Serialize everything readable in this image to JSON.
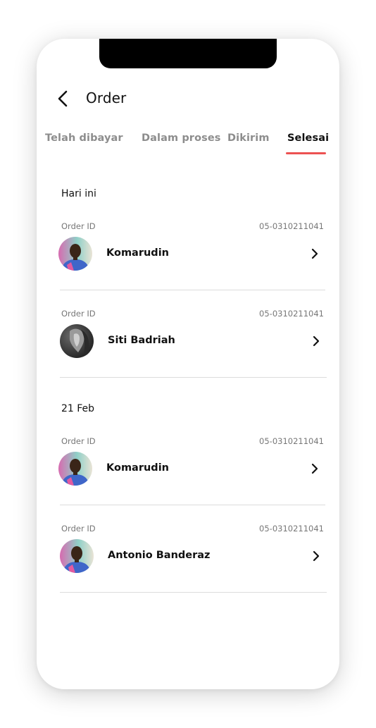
{
  "header": {
    "title": "Order",
    "back_icon": "chevron-left-icon"
  },
  "tabs": [
    {
      "label": "Telah dibayar",
      "active": false
    },
    {
      "label": "Dalam proses",
      "active": false
    },
    {
      "label": "Dikirim",
      "active": false
    },
    {
      "label": "Selesai",
      "active": true
    }
  ],
  "accent_color": "#ec5252",
  "sections": [
    {
      "title": "Hari ini",
      "orders": [
        {
          "order_id_label": "Order ID",
          "order_id": "05-0310211041",
          "name": "Komarudin",
          "avatar": "man-colorful-shirt-photo"
        },
        {
          "order_id_label": "Order ID",
          "order_id": "05-0310211041",
          "name": "Siti Badriah",
          "avatar": "woman-grayscale-photo"
        }
      ]
    },
    {
      "title": "21 Feb",
      "orders": [
        {
          "order_id_label": "Order ID",
          "order_id": "05-0310211041",
          "name": "Komarudin",
          "avatar": "man-colorful-shirt-photo"
        },
        {
          "order_id_label": "Order ID",
          "order_id": "05-0310211041",
          "name": "Antonio Banderaz",
          "avatar": "man-colorful-shirt-photo"
        }
      ]
    }
  ]
}
